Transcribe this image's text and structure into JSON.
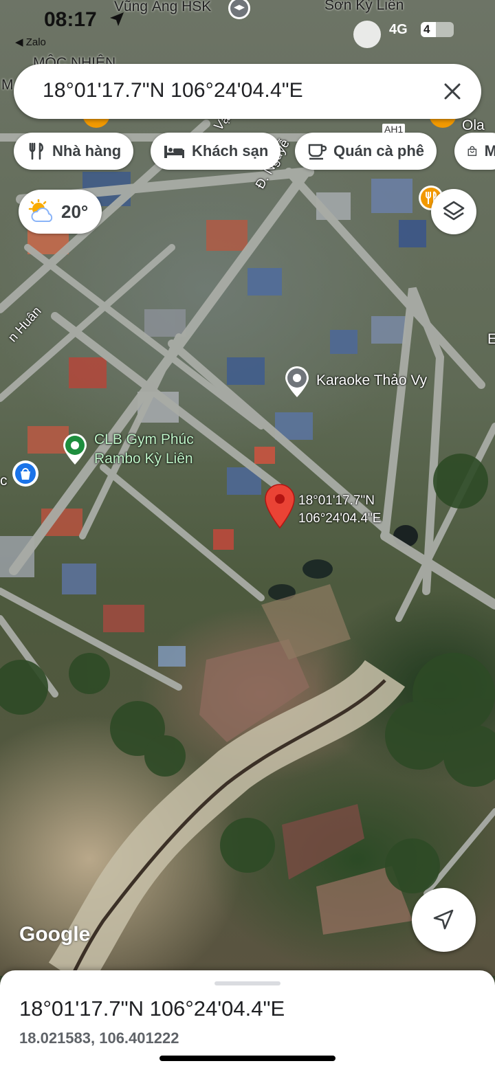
{
  "status_bar": {
    "time": "08:17",
    "back_app": "◀ Zalo",
    "network": "4G",
    "battery": "4",
    "battery_level": 0.45
  },
  "search": {
    "query": "18°01'17.7\"N 106°24'04.4\"E"
  },
  "chips": [
    {
      "label": "Nhà hàng",
      "icon": "restaurant-icon"
    },
    {
      "label": "Khách sạn",
      "icon": "hotel-icon"
    },
    {
      "label": "Quán cà phê",
      "icon": "coffee-icon"
    },
    {
      "label": "M",
      "icon": "shopping-bag-icon"
    }
  ],
  "weather": {
    "temperature": "20°",
    "icon": "partly-cloudy-icon"
  },
  "map_labels": {
    "top_left": "Vũng Áng HSK",
    "top_right": "Sơn Kỳ Liên",
    "mooc": "MỘC NHIÊN",
    "ola": "Ola",
    "ah1": "AH1",
    "street_nguyen": "Đ. Nguyễ",
    "street_huan": "n Huân",
    "karaoke": "Karaoke Thảo Vy",
    "gym_line1": "CLB Gym Phúc",
    "gym_line2": "Rambo Kỳ Liên",
    "edge_c": "c",
    "edge_e": "E",
    "edge_m": "M",
    "edge_v": "Vạ",
    "pin_lat": "18°01'17.7\"N",
    "pin_lng": "106°24'04.4\"E",
    "google": "Google"
  },
  "sheet": {
    "title": "18°01'17.7\"N 106°24'04.4\"E",
    "decimal": "18.021583, 106.401222"
  },
  "colors": {
    "pin_red": "#ea4335",
    "poi_green": "#1e8e3e",
    "poi_grey": "#70757a",
    "poi_orange": "#f29900",
    "poi_blue": "#1a73e8"
  }
}
